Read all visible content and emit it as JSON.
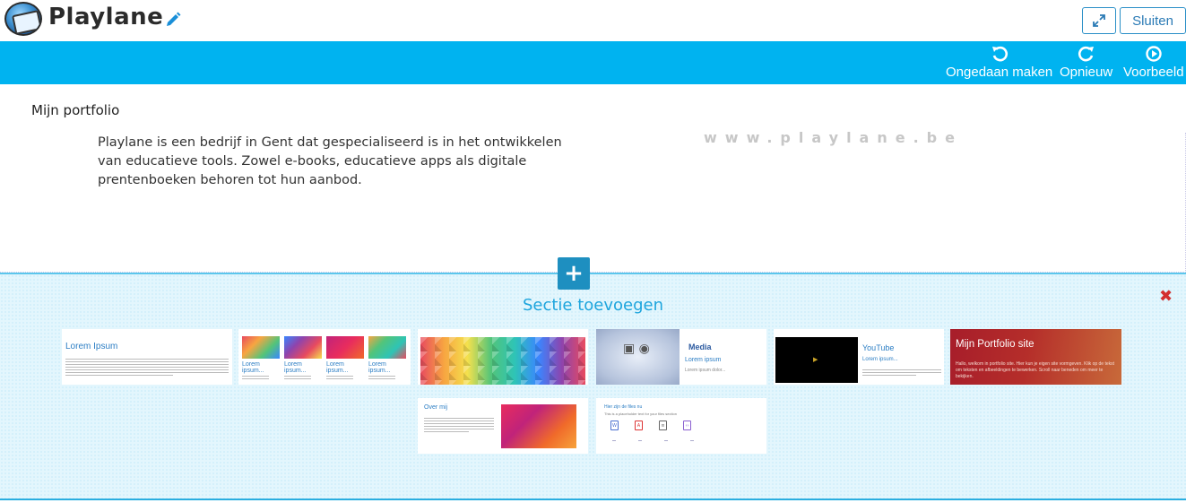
{
  "header": {
    "app_title": "Playlane",
    "logo_icon": "playlane-logo",
    "edit_icon": "pencil-icon",
    "expand_icon": "expand-icon",
    "close_label": "Sluiten"
  },
  "toolbar": {
    "background": "#00b3f0",
    "undo_label": "Ongedaan maken",
    "redo_label": "Opnieuw",
    "preview_label": "Voorbeeld"
  },
  "content": {
    "section_title": "Mijn portfolio",
    "paragraph": "Playlane is een bedrijf in Gent dat gespecialiseerd is in het ontwikkelen van educatieve tools. Zowel e-books, educatieve apps als digitale prentenboeken behoren tot hun aanbod.",
    "watermark": "www.playlane.be"
  },
  "add_section": {
    "plus_label": "+",
    "title": "Sectie toevoegen",
    "close_label": "✖",
    "accent_color": "#1ea5dd",
    "templates": {
      "text": {
        "heading": "Lorem Ipsum"
      },
      "gallery": {
        "captions": [
          "Lorem ipsum...",
          "Lorem ipsum...",
          "Lorem ipsum...",
          "Lorem ipsum..."
        ]
      },
      "media": {
        "heading": "Media",
        "subheading": "Lorem ipsum",
        "small": "Lorem ipsum dolor..."
      },
      "youtube": {
        "heading": "YouTube",
        "subheading": "Lorem ipsum..."
      },
      "portfolio": {
        "title": "Mijn Portfolio site",
        "subtitle": "Hallo, welkom in portfolio site. Hier kun je eigen site vormgeven. Klik op de tekst om teksten en afbeeldingen te bewerken. Scroll naar beneden om meer te bekijken."
      },
      "about": {
        "heading": "Over mij"
      },
      "files": {
        "heading": "Hier zijn de files nu",
        "subheading": "This is a placeholder text for your files section"
      }
    }
  }
}
